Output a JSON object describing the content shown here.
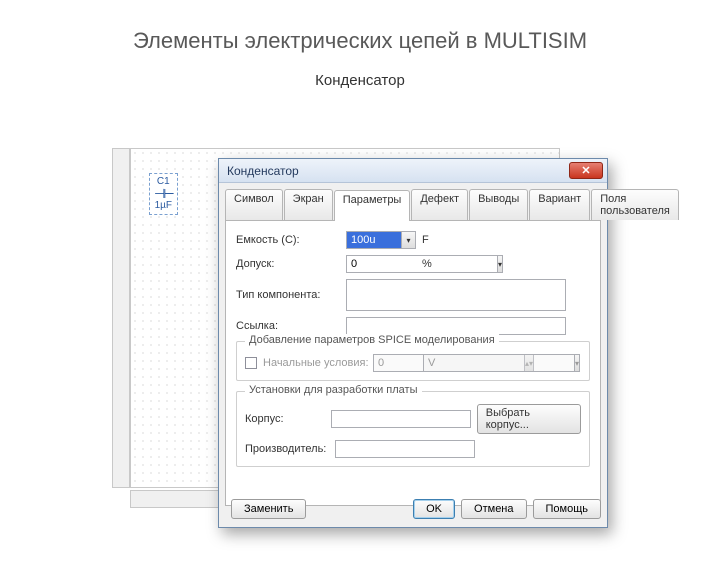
{
  "slide": {
    "title": "Элементы электрических цепей в MULTISIM",
    "subtitle": "Конденсатор"
  },
  "symbol": {
    "ref": "C1",
    "value": "1µF"
  },
  "dialog": {
    "title": "Конденсатор"
  },
  "tabs": [
    "Символ",
    "Экран",
    "Параметры",
    "Дефект",
    "Выводы",
    "Вариант",
    "Поля пользователя"
  ],
  "form": {
    "capacitance_label": "Емкость (C):",
    "capacitance_value": "100u",
    "capacitance_unit": "F",
    "tolerance_label": "Допуск:",
    "tolerance_value": "0",
    "tolerance_unit": "%",
    "type_label": "Тип компонента:",
    "type_value": "",
    "link_label": "Ссылка:",
    "link_value": ""
  },
  "spice_group": {
    "legend": "Добавление параметров SPICE моделирования",
    "ic_label": "Начальные условия:",
    "ic_value": "0",
    "ic_unit": "V"
  },
  "pcb_group": {
    "legend": "Установки для разработки платы",
    "footprint_label": "Корпус:",
    "footprint_value": "",
    "footprint_button": "Выбрать корпус...",
    "mfr_label": "Производитель:",
    "mfr_value": ""
  },
  "buttons": {
    "replace": "Заменить",
    "ok": "OK",
    "cancel": "Отмена",
    "help": "Помощь"
  }
}
